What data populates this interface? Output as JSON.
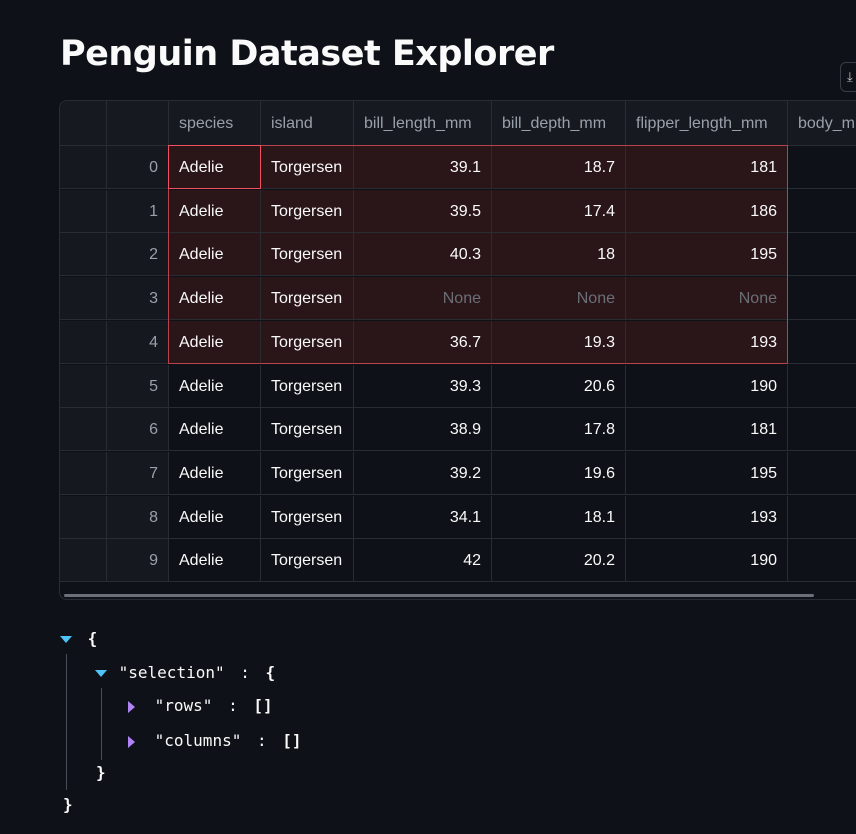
{
  "title": "Penguin Dataset Explorer",
  "toolbar_icon": "download-icon",
  "colors": {
    "selection_border": "#ef5160",
    "selection_fill": "#2a1519",
    "json_expand_open": "#4fc3f7",
    "json_expand_closed": "#b084f5"
  },
  "columns": [
    "species",
    "island",
    "bill_length_mm",
    "bill_depth_mm",
    "flipper_length_mm",
    "body_m"
  ],
  "rows": [
    {
      "index": "0",
      "species": "Adelie",
      "island": "Torgersen",
      "bill_length_mm": "39.1",
      "bill_depth_mm": "18.7",
      "flipper_length_mm": "181"
    },
    {
      "index": "1",
      "species": "Adelie",
      "island": "Torgersen",
      "bill_length_mm": "39.5",
      "bill_depth_mm": "17.4",
      "flipper_length_mm": "186"
    },
    {
      "index": "2",
      "species": "Adelie",
      "island": "Torgersen",
      "bill_length_mm": "40.3",
      "bill_depth_mm": "18",
      "flipper_length_mm": "195"
    },
    {
      "index": "3",
      "species": "Adelie",
      "island": "Torgersen",
      "bill_length_mm": "None",
      "bill_depth_mm": "None",
      "flipper_length_mm": "None"
    },
    {
      "index": "4",
      "species": "Adelie",
      "island": "Torgersen",
      "bill_length_mm": "36.7",
      "bill_depth_mm": "19.3",
      "flipper_length_mm": "193"
    },
    {
      "index": "5",
      "species": "Adelie",
      "island": "Torgersen",
      "bill_length_mm": "39.3",
      "bill_depth_mm": "20.6",
      "flipper_length_mm": "190"
    },
    {
      "index": "6",
      "species": "Adelie",
      "island": "Torgersen",
      "bill_length_mm": "38.9",
      "bill_depth_mm": "17.8",
      "flipper_length_mm": "181"
    },
    {
      "index": "7",
      "species": "Adelie",
      "island": "Torgersen",
      "bill_length_mm": "39.2",
      "bill_depth_mm": "19.6",
      "flipper_length_mm": "195"
    },
    {
      "index": "8",
      "species": "Adelie",
      "island": "Torgersen",
      "bill_length_mm": "34.1",
      "bill_depth_mm": "18.1",
      "flipper_length_mm": "193"
    },
    {
      "index": "9",
      "species": "Adelie",
      "island": "Torgersen",
      "bill_length_mm": "42",
      "bill_depth_mm": "20.2",
      "flipper_length_mm": "190"
    }
  ],
  "json_view": {
    "open_brace": "{",
    "close_brace": "}",
    "selection_key": "\"selection\"",
    "colon": ":",
    "rows_key": "\"rows\"",
    "rows_value": "[]",
    "columns_key": "\"columns\"",
    "columns_value": "[]"
  }
}
